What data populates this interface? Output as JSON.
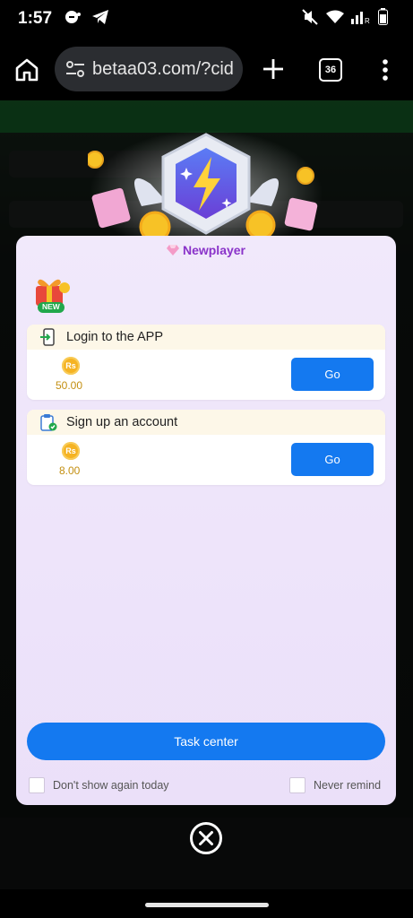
{
  "status_bar": {
    "time": "1:57",
    "icons": [
      "alarm-off-icon",
      "telegram-icon",
      "mute-icon",
      "wifi-icon",
      "signal-icon",
      "battery-icon"
    ]
  },
  "browser": {
    "url": "betaa03.com/?cid",
    "tab_count": "36",
    "icons": [
      "home-icon",
      "site-settings-icon",
      "plus-icon",
      "tabs-icon",
      "more-vert-icon"
    ]
  },
  "modal": {
    "title": "Newplayer",
    "new_badge": "NEW",
    "tasks": [
      {
        "label": "Login to the APP",
        "coin": "Rs",
        "amount": "50.00",
        "button": "Go"
      },
      {
        "label": "Sign up an account",
        "coin": "Rs",
        "amount": "8.00",
        "button": "Go"
      }
    ],
    "task_center_label": "Task center",
    "dont_show_label": "Don't show again today",
    "never_remind_label": "Never remind"
  },
  "colors": {
    "accent_blue": "#1479f0",
    "title_purple": "#8a33c9",
    "amount_gold": "#c38f11",
    "modal_bg": "#efe6fa"
  }
}
